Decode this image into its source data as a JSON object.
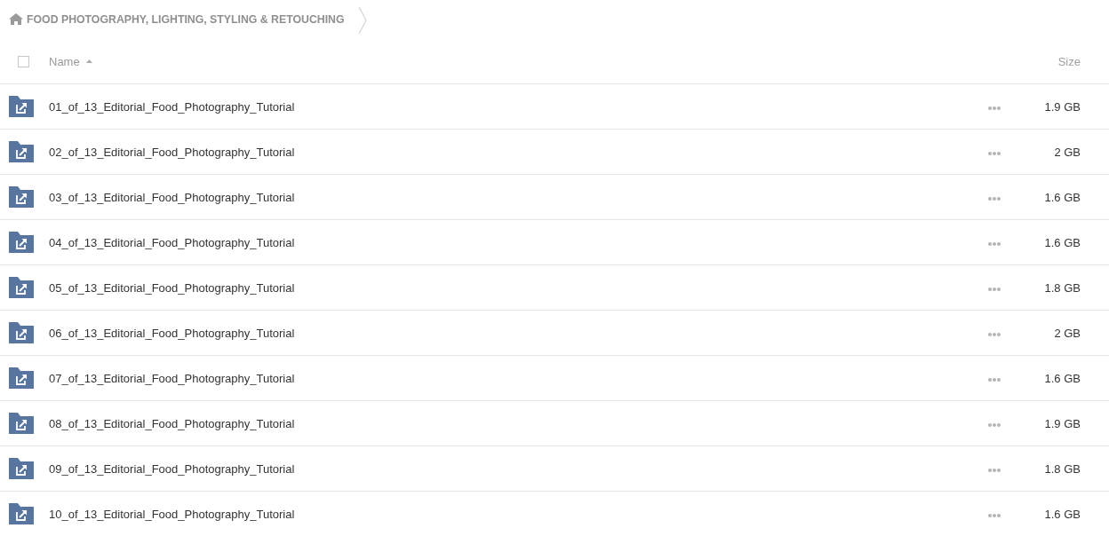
{
  "breadcrumb": {
    "items": [
      {
        "label": "FOOD PHOTOGRAPHY, LIGHTING, STYLING & RETOUCHING"
      }
    ]
  },
  "table": {
    "select_all": {
      "checked": false
    },
    "columns": [
      {
        "label": "Name",
        "sorted": true
      },
      {
        "label": "Size",
        "sorted": false
      }
    ],
    "rows": [
      {
        "name": "01_of_13_Editorial_Food_Photography_Tutorial",
        "size": "1.9 GB",
        "selected": false
      },
      {
        "name": "02_of_13_Editorial_Food_Photography_Tutorial",
        "size": "2 GB",
        "selected": false
      },
      {
        "name": "03_of_13_Editorial_Food_Photography_Tutorial",
        "size": "1.6 GB",
        "selected": false
      },
      {
        "name": "04_of_13_Editorial_Food_Photography_Tutorial",
        "size": "1.6 GB",
        "selected": false
      },
      {
        "name": "05_of_13_Editorial_Food_Photography_Tutorial",
        "size": "1.8 GB",
        "selected": false
      },
      {
        "name": "06_of_13_Editorial_Food_Photography_Tutorial",
        "size": "2 GB",
        "selected": false
      },
      {
        "name": "07_of_13_Editorial_Food_Photography_Tutorial",
        "size": "1.6 GB",
        "selected": false
      },
      {
        "name": "08_of_13_Editorial_Food_Photography_Tutorial",
        "size": "1.9 GB",
        "selected": false
      },
      {
        "name": "09_of_13_Editorial_Food_Photography_Tutorial",
        "size": "1.8 GB",
        "selected": false
      },
      {
        "name": "10_of_13_Editorial_Food_Photography_Tutorial",
        "size": "1.6 GB",
        "selected": false
      }
    ]
  }
}
